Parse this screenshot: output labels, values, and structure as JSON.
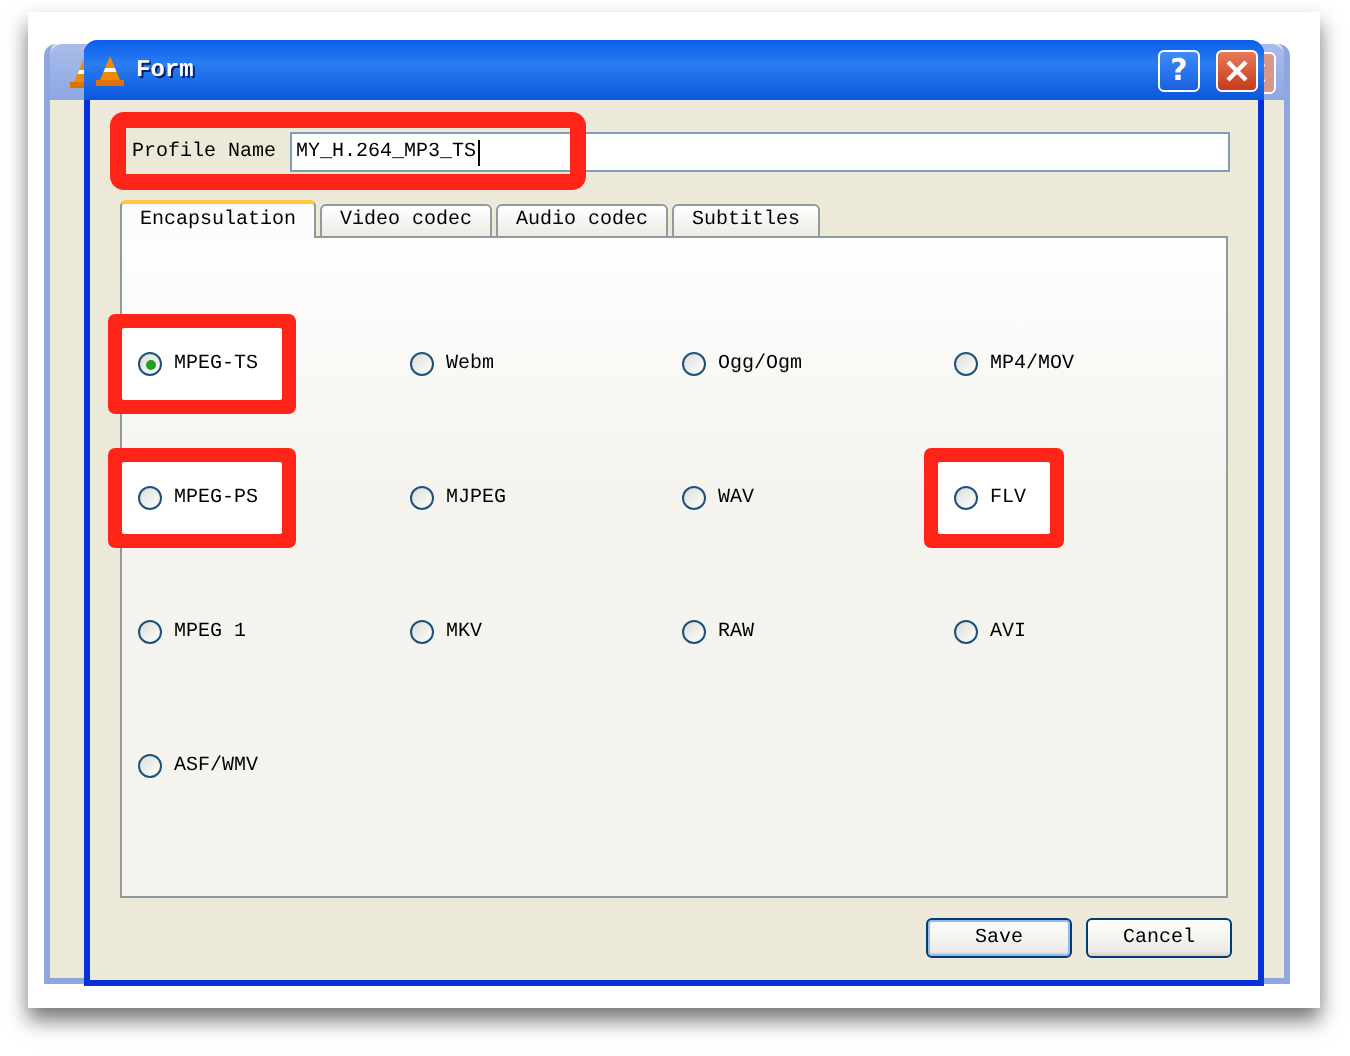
{
  "window": {
    "title": "Form",
    "help_button": "?"
  },
  "profile": {
    "label": "Profile Name",
    "value": "MY_H.264_MP3_TS",
    "highlighted": true
  },
  "tabs": [
    {
      "label": "Encapsulation",
      "selected": true
    },
    {
      "label": "Video codec",
      "selected": false
    },
    {
      "label": "Audio codec",
      "selected": false
    },
    {
      "label": "Subtitles",
      "selected": false
    }
  ],
  "options": [
    {
      "label": "MPEG-TS",
      "selected": true,
      "highlighted": true
    },
    {
      "label": "Webm",
      "selected": false,
      "highlighted": false
    },
    {
      "label": "Ogg/Ogm",
      "selected": false,
      "highlighted": false
    },
    {
      "label": "MP4/MOV",
      "selected": false,
      "highlighted": false
    },
    {
      "label": "MPEG-PS",
      "selected": false,
      "highlighted": true
    },
    {
      "label": "MJPEG",
      "selected": false,
      "highlighted": false
    },
    {
      "label": "WAV",
      "selected": false,
      "highlighted": false
    },
    {
      "label": "FLV",
      "selected": false,
      "highlighted": true
    },
    {
      "label": "MPEG 1",
      "selected": false,
      "highlighted": false
    },
    {
      "label": "MKV",
      "selected": false,
      "highlighted": false
    },
    {
      "label": "RAW",
      "selected": false,
      "highlighted": false
    },
    {
      "label": "AVI",
      "selected": false,
      "highlighted": false
    },
    {
      "label": "ASF/WMV",
      "selected": false,
      "highlighted": false
    }
  ],
  "buttons": [
    "Save",
    "Cancel"
  ]
}
